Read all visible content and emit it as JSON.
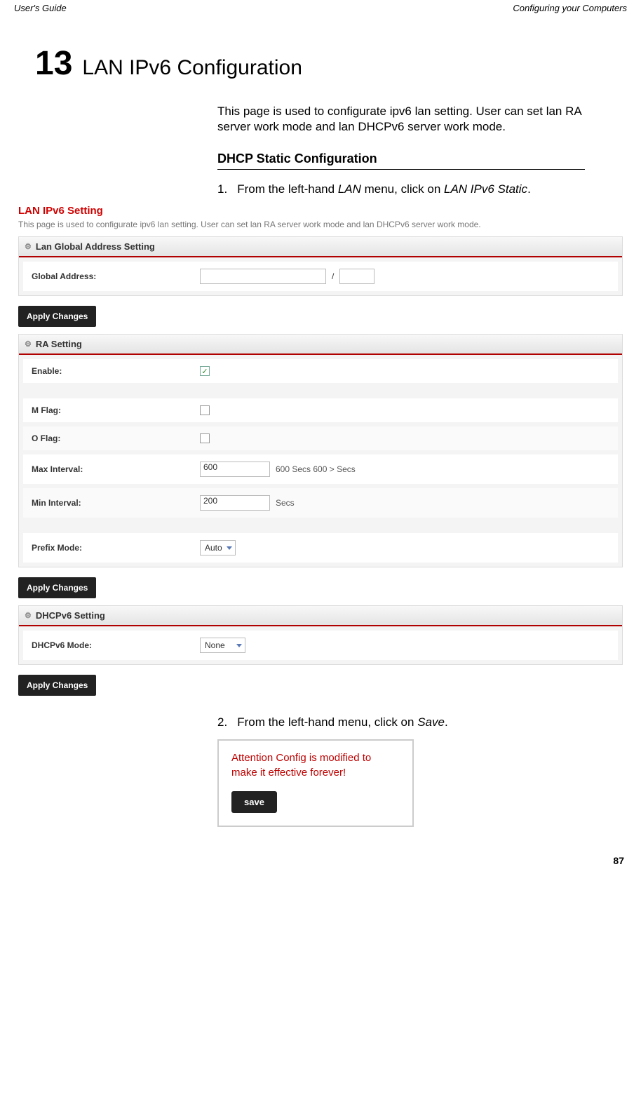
{
  "header": {
    "left": "User's Guide",
    "right": "Configuring your Computers"
  },
  "chapter": {
    "number": "13",
    "title": "LAN IPv6 Configuration"
  },
  "intro": "This page is used to configurate ipv6 lan setting. User can set lan RA server work mode and lan DHCPv6 server work mode.",
  "section_title": "DHCP Static Configuration",
  "step1": {
    "num": "1.",
    "prefix": "From the left-hand ",
    "em1": "LAN",
    "mid": " menu, click on ",
    "em2": "LAN IPv6 Static",
    "suffix": "."
  },
  "screenshot": {
    "title": "LAN IPv6 Setting",
    "desc": "This page is used to configurate ipv6 lan setting. User can set lan RA server work mode and lan DHCPv6 server work mode.",
    "panel_global": "Lan Global Address Setting",
    "global_addr_label": "Global Address:",
    "slash": "/",
    "apply": "Apply Changes",
    "panel_ra": "RA Setting",
    "enable_label": "Enable:",
    "mflag_label": "M Flag:",
    "oflag_label": "O Flag:",
    "maxint_label": "Max Interval:",
    "maxint_val": "600",
    "maxint_help": "600 Secs 600 > Secs",
    "minint_label": "Min Interval:",
    "minint_val": "200",
    "minint_help": "Secs",
    "prefix_label": "Prefix Mode:",
    "prefix_val": "Auto",
    "panel_dhcp": "DHCPv6 Setting",
    "dhcp_mode_label": "DHCPv6 Mode:",
    "dhcp_mode_val": "None"
  },
  "step2": {
    "num": "2.",
    "prefix": "From the left-hand menu, click on ",
    "em1": "Save",
    "suffix": "."
  },
  "save_box": {
    "msg": "Attention Config is modified to make it effective forever!",
    "btn": "save"
  },
  "page_number": "87"
}
